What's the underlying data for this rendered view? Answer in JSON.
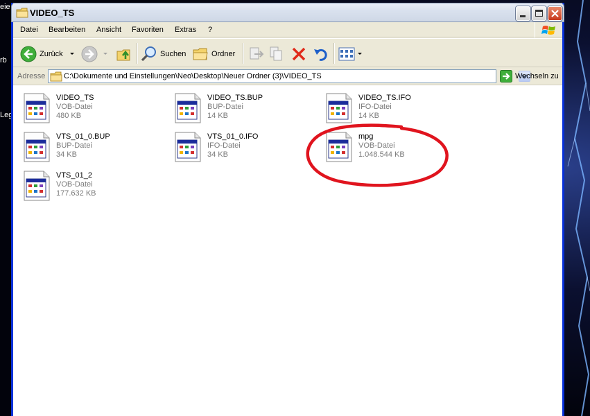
{
  "desktop": {
    "fragments": [
      "eie",
      "rb",
      "Leg"
    ]
  },
  "window": {
    "title": "VIDEO_TS"
  },
  "menu": [
    "Datei",
    "Bearbeiten",
    "Ansicht",
    "Favoriten",
    "Extras",
    "?"
  ],
  "toolbar": {
    "back_label": "Zurück",
    "search_label": "Suchen",
    "folders_label": "Ordner"
  },
  "address": {
    "label": "Adresse",
    "path": "C:\\Dokumente und Einstellungen\\Neo\\Desktop\\Neuer Ordner (3)\\VIDEO_TS",
    "go_label": "Wechseln zu"
  },
  "files": [
    {
      "name": "VIDEO_TS",
      "type": "VOB-Datei",
      "size": "480 KB"
    },
    {
      "name": "VIDEO_TS.BUP",
      "type": "BUP-Datei",
      "size": "14 KB"
    },
    {
      "name": "VIDEO_TS.IFO",
      "type": "IFO-Datei",
      "size": "14 KB"
    },
    {
      "name": "VTS_01_0.BUP",
      "type": "BUP-Datei",
      "size": "34 KB"
    },
    {
      "name": "VTS_01_0.IFO",
      "type": "IFO-Datei",
      "size": "34 KB"
    },
    {
      "name": "mpg",
      "type": "VOB-Datei",
      "size": "1.048.544 KB"
    },
    {
      "name": "VTS_01_2",
      "type": "VOB-Datei",
      "size": "177.632 KB"
    }
  ],
  "colors": {
    "highlight_circle": "#e0141e",
    "window_border": "#0831d9"
  }
}
